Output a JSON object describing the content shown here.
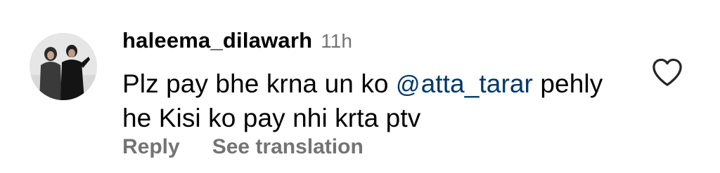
{
  "comment": {
    "username": "haleema_dilawarh",
    "timestamp": "11h",
    "text_before_mention": "Plz pay bhe krna un ko ",
    "mention": "atta_tarar",
    "text_after_mention": " pehly he Kisi ko pay nhi krta ptv",
    "reply_label": "Reply",
    "translate_label": "See translation"
  },
  "icons": {
    "avatar": "profile-photo",
    "mention": "threads-icon",
    "like": "heart-outline-icon"
  },
  "colors": {
    "text": "#000000",
    "secondary": "#737373",
    "mention_link": "#00376b"
  }
}
